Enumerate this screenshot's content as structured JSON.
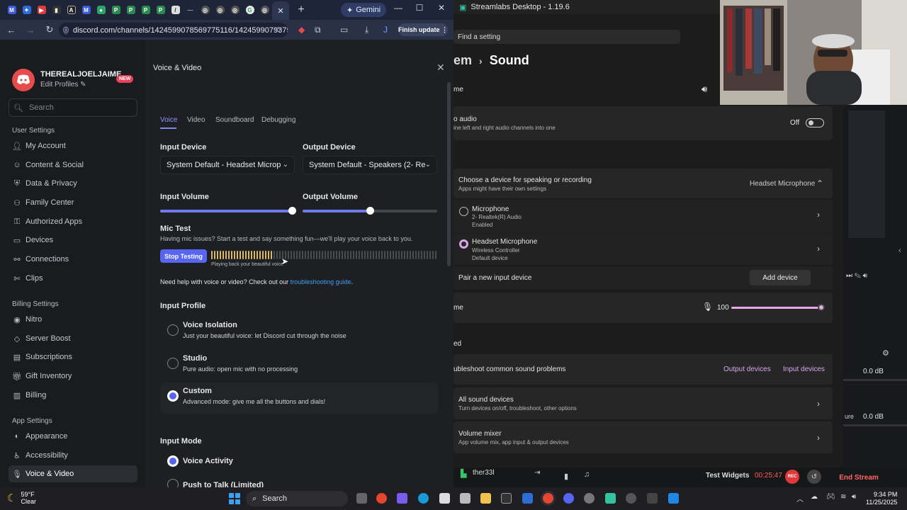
{
  "browser": {
    "gemini_label": "Gemini",
    "url": "discord.com/channels/1424599078569775116/1424599079375240...",
    "finish_update": "Finish update"
  },
  "discord": {
    "username": "THEREALJOELJAIME",
    "new_badge": "NEW",
    "edit_profiles": "Edit Profiles",
    "search_placeholder": "Search",
    "user_settings_header": "User Settings",
    "user_settings": [
      "My Account",
      "Content & Social",
      "Data & Privacy",
      "Family Center",
      "Authorized Apps",
      "Devices",
      "Connections",
      "Clips"
    ],
    "billing_header": "Billing Settings",
    "billing": [
      "Nitro",
      "Server Boost",
      "Subscriptions",
      "Gift Inventory",
      "Billing"
    ],
    "app_header": "App Settings",
    "app": [
      "Appearance",
      "Accessibility",
      "Voice & Video"
    ],
    "page_title": "Voice & Video",
    "tabs": [
      "Voice",
      "Video",
      "Soundboard",
      "Debugging"
    ],
    "input_device_label": "Input Device",
    "input_device": "System Default - Headset Microp",
    "output_device_label": "Output Device",
    "output_device": "System Default - Speakers (2- Re",
    "input_volume_label": "Input Volume",
    "input_volume": 0.98,
    "output_volume_label": "Output Volume",
    "output_volume": 0.5,
    "mic_test_label": "Mic Test",
    "mic_test_desc": "Having mic issues? Start a test and say something fun—we'll play your voice back to you.",
    "stop_testing": "Stop Testing",
    "playback_note": "Playing back your beautiful voice",
    "mic_level": 0.28,
    "help_prefix": "Need help with voice or video? Check out our ",
    "help_link": "troubleshooting guide",
    "help_suffix": ".",
    "input_profile_label": "Input Profile",
    "profiles": [
      {
        "title": "Voice Isolation",
        "desc": "Just your beautiful voice: let Discord cut through the noise"
      },
      {
        "title": "Studio",
        "desc": "Pure audio: open mic with no processing"
      },
      {
        "title": "Custom",
        "desc": "Advanced mode: give me all the buttons and dials!"
      }
    ],
    "input_mode_label": "Input Mode",
    "voice_activity": "Voice Activity",
    "push_to_talk": "Push to Talk (Limited)"
  },
  "settings": {
    "streamlabs_title": "Streamlabs Desktop - 1.19.6",
    "find_setting": "Find a setting",
    "breadcrumb_left": "em",
    "breadcrumb_right": "Sound",
    "me_cut": "me",
    "mono_title": "o audio",
    "mono_desc": "ine left and right audio channels into one",
    "mono_state": "Off",
    "choose_device": "Choose a device for speaking or recording",
    "choose_device_sub": "Apps might have their own settings",
    "selected_device": "Headset Microphone",
    "mic_name": "Microphone",
    "mic_sub1": "2- Realtek(R) Audio",
    "mic_sub2": "Enabled",
    "headset_name": "Headset Microphone",
    "headset_sub1": "Wireless Controller",
    "headset_sub2": "Default device",
    "pair_new": "Pair a new input device",
    "add_device": "Add device",
    "volume_cut": "me",
    "volume_value": "100",
    "advanced_cut": "ed",
    "troubleshoot": "ubleshoot common sound problems",
    "output_devices": "Output devices",
    "input_devices": "Input devices",
    "all_sound": "All sound devices",
    "all_sound_sub": "Turn devices on/off, troubleshoot, other options",
    "mixer": "Volume mixer",
    "mixer_sub": "App volume mix, app input & output devices"
  },
  "streamlabs": {
    "user": "ther33l",
    "test_widgets": "Test Widgets",
    "timer": "00:25:47",
    "rec": "REC",
    "end_stream": "End Stream",
    "db1": "0.0 dB",
    "db2": "0.0 dB",
    "ure": "ure"
  },
  "taskbar": {
    "temp": "59°F",
    "condition": "Clear",
    "search": "Search",
    "time": "9:34 PM",
    "date": "11/25/2025"
  },
  "colors": {
    "discord_blurple": "#5865f2",
    "mic_meter_active": "#d7b86a",
    "win_accent": "#d8a6e8",
    "rec_red": "#e0393b"
  }
}
